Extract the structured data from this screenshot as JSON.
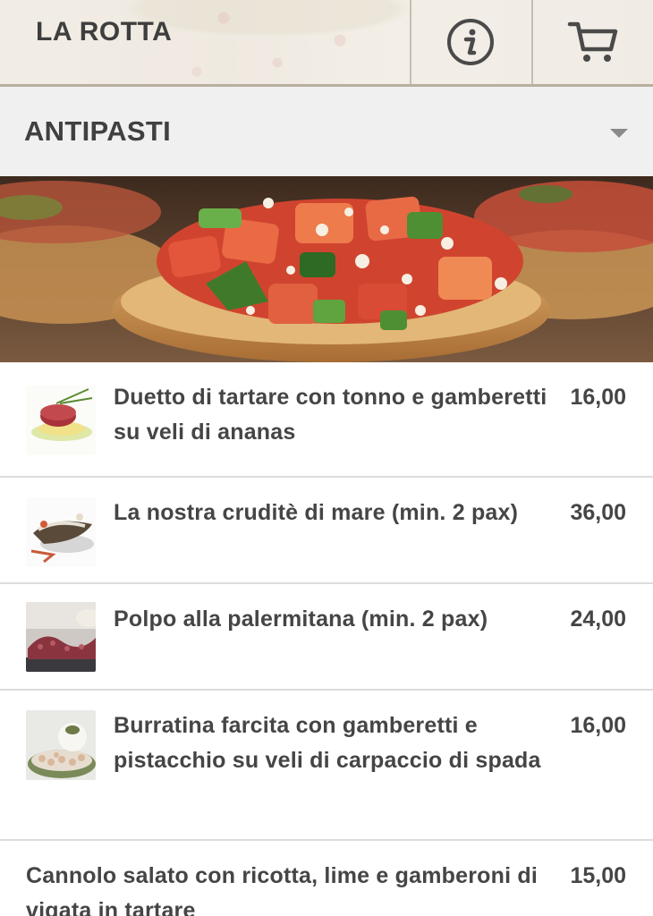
{
  "header": {
    "title": "LA ROTTA",
    "info_icon": "info-icon",
    "cart_icon": "cart-icon"
  },
  "category": {
    "label": "ANTIPASTI",
    "dropdown_icon": "caret-down-icon"
  },
  "menu": {
    "items": [
      {
        "name": "Duetto di tartare con tonno e gamberetti su veli di ananas",
        "price": "16,00"
      },
      {
        "name": "La nostra cruditè di mare (min. 2 pax)",
        "price": "36,00"
      },
      {
        "name": "Polpo alla palermitana (min. 2 pax)",
        "price": "24,00"
      },
      {
        "name": "Burratina farcita con gamberetti e pistacchio su veli di carpaccio di spada",
        "price": "16,00"
      },
      {
        "name": "Cannolo salato con ricotta, lime e gamberoni di vigata in tartare",
        "price": "15,00"
      }
    ]
  },
  "colors": {
    "text": "#454545",
    "category_bg": "#f0f0f0",
    "divider": "#dcdcdc"
  }
}
